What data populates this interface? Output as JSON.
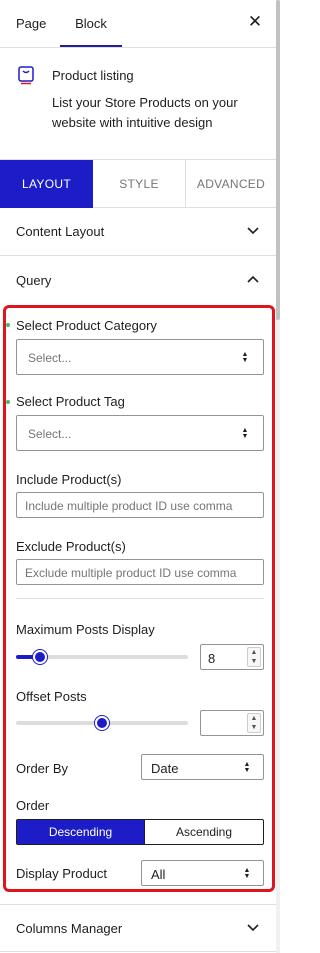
{
  "header": {
    "tabs": [
      {
        "label": "Page"
      },
      {
        "label": "Block"
      }
    ],
    "close_icon": "close-icon"
  },
  "block": {
    "icon": "product-listing-icon",
    "title": "Product listing",
    "description": "List your Store Products on your website with intuitive design"
  },
  "layout_tabs": [
    {
      "label": "LAYOUT"
    },
    {
      "label": "STYLE"
    },
    {
      "label": "ADVANCED"
    }
  ],
  "panels": {
    "content_layout": {
      "label": "Content Layout"
    },
    "query": {
      "label": "Query"
    },
    "columns_manager": {
      "label": "Columns Manager"
    }
  },
  "query": {
    "category": {
      "label": "Select Product Category",
      "value": "Select..."
    },
    "tag": {
      "label": "Select Product Tag",
      "value": "Select..."
    },
    "include": {
      "label": "Include Product(s)",
      "placeholder": "Include multiple product ID use comma"
    },
    "exclude": {
      "label": "Exclude Product(s)",
      "placeholder": "Exclude multiple product ID use comma"
    },
    "max_posts": {
      "label": "Maximum Posts Display",
      "value": "8",
      "slider_fraction": 0.14
    },
    "offset": {
      "label": "Offset Posts",
      "value": "",
      "slider_fraction": 0.5
    },
    "order_by": {
      "label": "Order By",
      "value": "Date"
    },
    "order": {
      "label": "Order",
      "options": [
        {
          "label": "Descending"
        },
        {
          "label": "Ascending"
        }
      ],
      "selected": "Descending"
    },
    "display_product": {
      "label": "Display Product",
      "value": "All"
    }
  },
  "colors": {
    "accent": "#1d1dc8",
    "highlight_border": "#e0141c",
    "status_dot": "#4ab866"
  }
}
